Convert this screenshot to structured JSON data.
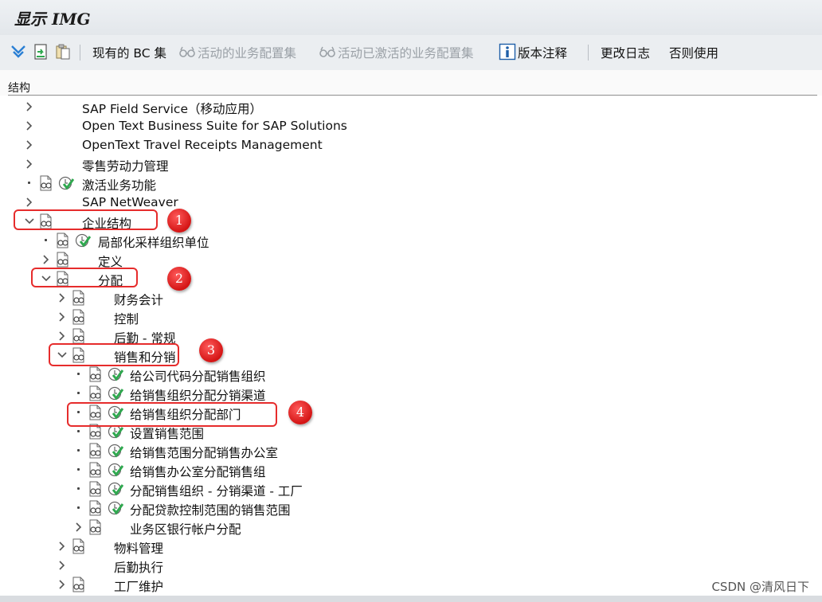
{
  "window": {
    "title": "显示 IMG"
  },
  "toolbar": {
    "existing_bc_sets": "现有的 BC 集",
    "active_bc_sets": "活动的业务配置集",
    "activated_bc_sets": "活动已激活的业务配置集",
    "release_notes": "版本注释",
    "change_log": "更改日志",
    "where_used": "否则使用"
  },
  "structure": {
    "header": "结构",
    "nodes": [
      {
        "label": "SAP Field Service（移动应用）",
        "level": 1,
        "state": "collapsed",
        "doc_icon": false,
        "exec_icon": false
      },
      {
        "label": "Open Text Business Suite for SAP Solutions",
        "level": 1,
        "state": "collapsed",
        "doc_icon": false,
        "exec_icon": false
      },
      {
        "label": "OpenText Travel Receipts Management",
        "level": 1,
        "state": "collapsed",
        "doc_icon": false,
        "exec_icon": false
      },
      {
        "label": "零售劳动力管理",
        "level": 1,
        "state": "collapsed",
        "doc_icon": false,
        "exec_icon": false
      },
      {
        "label": "激活业务功能",
        "level": 1,
        "state": "leaf",
        "doc_icon": true,
        "exec_icon": true
      },
      {
        "label": "SAP NetWeaver",
        "level": 1,
        "state": "collapsed",
        "doc_icon": false,
        "exec_icon": false
      },
      {
        "label": "企业结构",
        "level": 1,
        "state": "expanded",
        "doc_icon": true,
        "exec_icon": false
      },
      {
        "label": "局部化采样组织单位",
        "level": 2,
        "state": "leaf",
        "doc_icon": true,
        "exec_icon": true
      },
      {
        "label": "定义",
        "level": 2,
        "state": "collapsed",
        "doc_icon": true,
        "exec_icon": false
      },
      {
        "label": "分配",
        "level": 2,
        "state": "expanded",
        "doc_icon": true,
        "exec_icon": false
      },
      {
        "label": "财务会计",
        "level": 3,
        "state": "collapsed",
        "doc_icon": true,
        "exec_icon": false
      },
      {
        "label": "控制",
        "level": 3,
        "state": "collapsed",
        "doc_icon": true,
        "exec_icon": false
      },
      {
        "label": "后勤 - 常规",
        "level": 3,
        "state": "collapsed",
        "doc_icon": true,
        "exec_icon": false
      },
      {
        "label": "销售和分销",
        "level": 3,
        "state": "expanded",
        "doc_icon": true,
        "exec_icon": false
      },
      {
        "label": "给公司代码分配销售组织",
        "level": 4,
        "state": "leaf",
        "doc_icon": true,
        "exec_icon": true
      },
      {
        "label": "给销售组织分配分销渠道",
        "level": 4,
        "state": "leaf",
        "doc_icon": true,
        "exec_icon": true
      },
      {
        "label": "给销售组织分配部门",
        "level": 4,
        "state": "leaf",
        "doc_icon": true,
        "exec_icon": true
      },
      {
        "label": "设置销售范围",
        "level": 4,
        "state": "leaf",
        "doc_icon": true,
        "exec_icon": true
      },
      {
        "label": "给销售范围分配销售办公室",
        "level": 4,
        "state": "leaf",
        "doc_icon": true,
        "exec_icon": true
      },
      {
        "label": "给销售办公室分配销售组",
        "level": 4,
        "state": "leaf",
        "doc_icon": true,
        "exec_icon": true
      },
      {
        "label": "分配销售组织 - 分销渠道 - 工厂",
        "level": 4,
        "state": "leaf",
        "doc_icon": true,
        "exec_icon": true
      },
      {
        "label": "分配贷款控制范围的销售范围",
        "level": 4,
        "state": "leaf",
        "doc_icon": true,
        "exec_icon": true
      },
      {
        "label": "业务区银行帐户分配",
        "level": 4,
        "state": "collapsed",
        "doc_icon": true,
        "exec_icon": false
      },
      {
        "label": "物料管理",
        "level": 3,
        "state": "collapsed",
        "doc_icon": true,
        "exec_icon": false
      },
      {
        "label": "后勤执行",
        "level": 3,
        "state": "collapsed",
        "doc_icon": false,
        "exec_icon": false
      },
      {
        "label": "工厂维护",
        "level": 3,
        "state": "collapsed",
        "doc_icon": true,
        "exec_icon": false
      }
    ]
  },
  "annotations": [
    {
      "number": "1",
      "target": "企业结构"
    },
    {
      "number": "2",
      "target": "分配"
    },
    {
      "number": "3",
      "target": "销售和分销"
    },
    {
      "number": "4",
      "target": "给销售组织分配部门"
    }
  ],
  "colors": {
    "callout_red": "#e62c2c",
    "exec_green": "#2fa84f",
    "toolbar_blue": "#2a7fd4"
  },
  "watermark": "CSDN @清风日下"
}
